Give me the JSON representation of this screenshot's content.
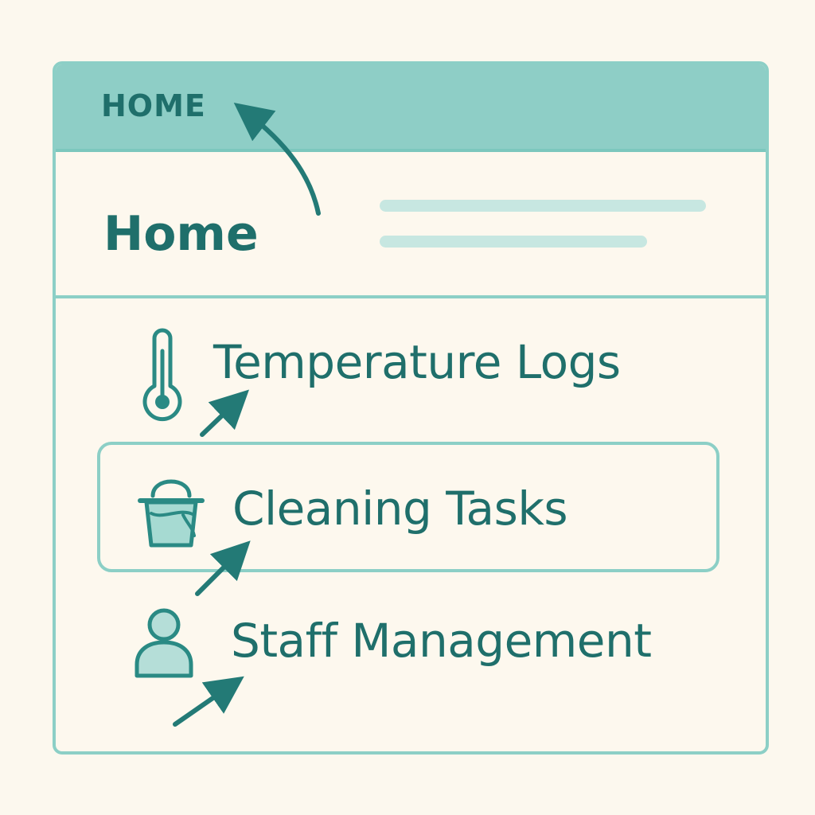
{
  "window": {
    "title": "HOME"
  },
  "header": {
    "page_title": "Home"
  },
  "nav": {
    "items": [
      {
        "label": "Temperature Logs",
        "icon": "thermometer-icon"
      },
      {
        "label": "Cleaning Tasks",
        "icon": "bucket-icon",
        "selected": true
      },
      {
        "label": "Staff Management",
        "icon": "user-icon"
      }
    ]
  },
  "colors": {
    "background": "#fcf8ee",
    "accent": "#8ecec6",
    "accent_border": "#8ccfc6",
    "text": "#1f6f6b",
    "placeholder": "#c7e7e1"
  }
}
